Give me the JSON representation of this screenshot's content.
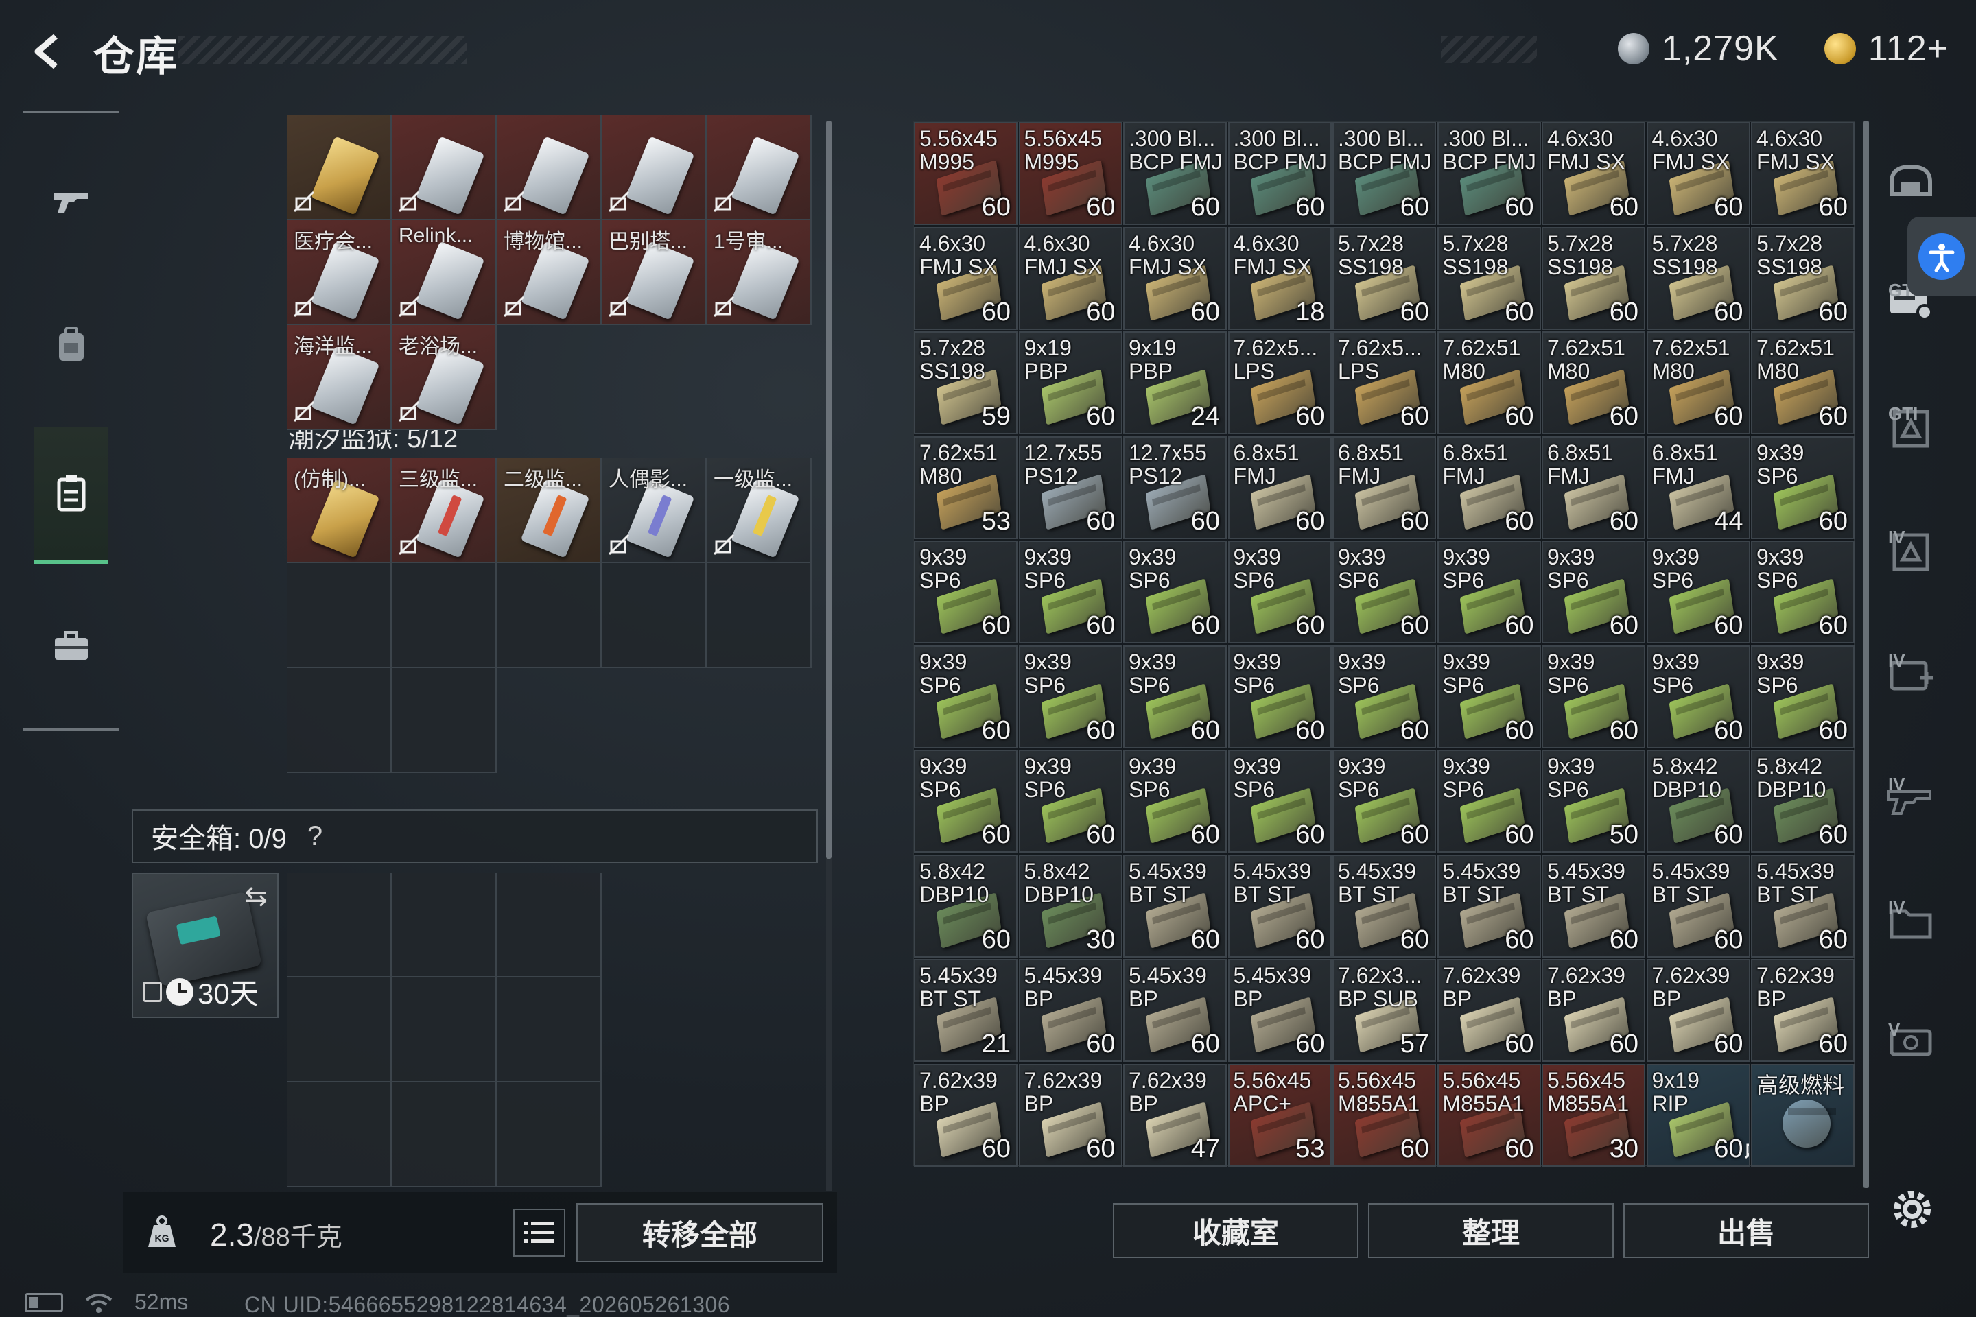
{
  "header": {
    "title": "仓库",
    "silver_amount": "1,279K",
    "gold_amount": "112+"
  },
  "left_nav": {
    "items": [
      "weapons",
      "backpack",
      "storage",
      "briefcase"
    ],
    "active": "storage"
  },
  "storage": {
    "top_rows": [
      [
        "",
        "",
        "",
        "",
        ""
      ],
      [
        "医疗会...",
        "Relink...",
        "博物馆...",
        "巴别塔...",
        "1号审..."
      ],
      [
        "海洋监...",
        "老浴场..."
      ]
    ],
    "section_label": "潮汐监狱: 5/12",
    "prison_cards": [
      "(仿制)...",
      "三级监...",
      "二级监...",
      "人偶影...",
      "一级监..."
    ]
  },
  "safe_box": {
    "header_label": "安全箱: 0/9",
    "help": "?",
    "duration": "30天"
  },
  "bottom_left": {
    "weight_value": "2.3",
    "weight_capacity": "/88千克",
    "transfer_all": "转移全部"
  },
  "status": {
    "ping": "52ms",
    "uid": "CN UID:5466655298122814634_202605261306"
  },
  "ammo_rows": [
    [
      [
        "5.56x45",
        "M995",
        "60",
        "red"
      ],
      [
        "5.56x45",
        "M995",
        "60",
        "red"
      ],
      [
        ".300 Bl...",
        "BCP FMJ",
        "60",
        ""
      ],
      [
        ".300 Bl...",
        "BCP FMJ",
        "60",
        ""
      ],
      [
        ".300 Bl...",
        "BCP FMJ",
        "60",
        ""
      ],
      [
        ".300 Bl...",
        "BCP FMJ",
        "60",
        ""
      ],
      [
        "4.6x30",
        "FMJ SX",
        "60",
        ""
      ],
      [
        "4.6x30",
        "FMJ SX",
        "60",
        ""
      ],
      [
        "4.6x30",
        "FMJ SX",
        "60",
        ""
      ]
    ],
    [
      [
        "4.6x30",
        "FMJ SX",
        "60",
        ""
      ],
      [
        "4.6x30",
        "FMJ SX",
        "60",
        ""
      ],
      [
        "4.6x30",
        "FMJ SX",
        "60",
        ""
      ],
      [
        "4.6x30",
        "FMJ SX",
        "18",
        ""
      ],
      [
        "5.7x28",
        "SS198",
        "60",
        ""
      ],
      [
        "5.7x28",
        "SS198",
        "60",
        ""
      ],
      [
        "5.7x28",
        "SS198",
        "60",
        ""
      ],
      [
        "5.7x28",
        "SS198",
        "60",
        ""
      ],
      [
        "5.7x28",
        "SS198",
        "60",
        ""
      ]
    ],
    [
      [
        "5.7x28",
        "SS198",
        "59",
        ""
      ],
      [
        "9x19",
        "PBP",
        "60",
        ""
      ],
      [
        "9x19",
        "PBP",
        "24",
        ""
      ],
      [
        "7.62x5...",
        "LPS",
        "60",
        ""
      ],
      [
        "7.62x5...",
        "LPS",
        "60",
        ""
      ],
      [
        "7.62x51",
        "M80",
        "60",
        ""
      ],
      [
        "7.62x51",
        "M80",
        "60",
        ""
      ],
      [
        "7.62x51",
        "M80",
        "60",
        ""
      ],
      [
        "7.62x51",
        "M80",
        "60",
        ""
      ]
    ],
    [
      [
        "7.62x51",
        "M80",
        "53",
        ""
      ],
      [
        "12.7x55",
        "PS12",
        "60",
        ""
      ],
      [
        "12.7x55",
        "PS12",
        "60",
        ""
      ],
      [
        "6.8x51",
        "FMJ",
        "60",
        ""
      ],
      [
        "6.8x51",
        "FMJ",
        "60",
        ""
      ],
      [
        "6.8x51",
        "FMJ",
        "60",
        ""
      ],
      [
        "6.8x51",
        "FMJ",
        "60",
        ""
      ],
      [
        "6.8x51",
        "FMJ",
        "44",
        ""
      ],
      [
        "9x39",
        "SP6",
        "60",
        ""
      ]
    ],
    [
      [
        "9x39",
        "SP6",
        "60",
        ""
      ],
      [
        "9x39",
        "SP6",
        "60",
        ""
      ],
      [
        "9x39",
        "SP6",
        "60",
        ""
      ],
      [
        "9x39",
        "SP6",
        "60",
        ""
      ],
      [
        "9x39",
        "SP6",
        "60",
        ""
      ],
      [
        "9x39",
        "SP6",
        "60",
        ""
      ],
      [
        "9x39",
        "SP6",
        "60",
        ""
      ],
      [
        "9x39",
        "SP6",
        "60",
        ""
      ],
      [
        "9x39",
        "SP6",
        "60",
        ""
      ]
    ],
    [
      [
        "9x39",
        "SP6",
        "60",
        ""
      ],
      [
        "9x39",
        "SP6",
        "60",
        ""
      ],
      [
        "9x39",
        "SP6",
        "60",
        ""
      ],
      [
        "9x39",
        "SP6",
        "60",
        ""
      ],
      [
        "9x39",
        "SP6",
        "60",
        ""
      ],
      [
        "9x39",
        "SP6",
        "60",
        ""
      ],
      [
        "9x39",
        "SP6",
        "60",
        ""
      ],
      [
        "9x39",
        "SP6",
        "60",
        ""
      ],
      [
        "9x39",
        "SP6",
        "60",
        ""
      ]
    ],
    [
      [
        "9x39",
        "SP6",
        "60",
        ""
      ],
      [
        "9x39",
        "SP6",
        "60",
        ""
      ],
      [
        "9x39",
        "SP6",
        "60",
        ""
      ],
      [
        "9x39",
        "SP6",
        "60",
        ""
      ],
      [
        "9x39",
        "SP6",
        "60",
        ""
      ],
      [
        "9x39",
        "SP6",
        "60",
        ""
      ],
      [
        "9x39",
        "SP6",
        "50",
        ""
      ],
      [
        "5.8x42",
        "DBP10",
        "60",
        ""
      ],
      [
        "5.8x42",
        "DBP10",
        "60",
        ""
      ]
    ],
    [
      [
        "5.8x42",
        "DBP10",
        "60",
        ""
      ],
      [
        "5.8x42",
        "DBP10",
        "30",
        ""
      ],
      [
        "5.45x39",
        "BT ST",
        "60",
        ""
      ],
      [
        "5.45x39",
        "BT ST",
        "60",
        ""
      ],
      [
        "5.45x39",
        "BT ST",
        "60",
        ""
      ],
      [
        "5.45x39",
        "BT ST",
        "60",
        ""
      ],
      [
        "5.45x39",
        "BT ST",
        "60",
        ""
      ],
      [
        "5.45x39",
        "BT ST",
        "60",
        ""
      ],
      [
        "5.45x39",
        "BT ST",
        "60",
        ""
      ]
    ],
    [
      [
        "5.45x39",
        "BT ST",
        "21",
        ""
      ],
      [
        "5.45x39",
        "BP",
        "60",
        ""
      ],
      [
        "5.45x39",
        "BP",
        "60",
        ""
      ],
      [
        "5.45x39",
        "BP",
        "60",
        ""
      ],
      [
        "7.62x3...",
        "BP SUB",
        "57",
        ""
      ],
      [
        "7.62x39",
        "BP",
        "60",
        ""
      ],
      [
        "7.62x39",
        "BP",
        "60",
        ""
      ],
      [
        "7.62x39",
        "BP",
        "60",
        ""
      ],
      [
        "7.62x39",
        "BP",
        "60",
        ""
      ]
    ],
    [
      [
        "7.62x39",
        "BP",
        "60",
        ""
      ],
      [
        "7.62x39",
        "BP",
        "60",
        ""
      ],
      [
        "7.62x39",
        "BP",
        "47",
        ""
      ],
      [
        "5.56x45",
        "APC+",
        "53",
        "red"
      ],
      [
        "5.56x45",
        "M855A1",
        "60",
        "red"
      ],
      [
        "5.56x45",
        "M855A1",
        "60",
        "red"
      ],
      [
        "5.56x45",
        "M855A1",
        "30",
        "red"
      ],
      [
        "9x19",
        "RIP",
        "60",
        "rare"
      ],
      [
        "高级燃料",
        "",
        "",
        "rare"
      ]
    ]
  ],
  "bottom_right": {
    "collection": "收藏室",
    "organize": "整理",
    "sell": "出售"
  },
  "right_nav_labels": [
    "GTI",
    "GTI",
    "IV",
    "IV",
    "IV",
    "IV",
    "V"
  ]
}
